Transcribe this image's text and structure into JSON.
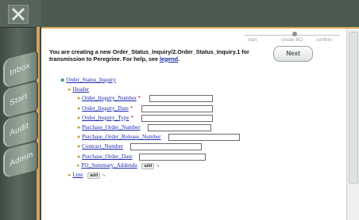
{
  "nav": {
    "tabs": [
      {
        "label": "Inbox"
      },
      {
        "label": "Start"
      },
      {
        "label": "Audit"
      },
      {
        "label": "Admin"
      }
    ]
  },
  "wizard": {
    "steps": [
      "start",
      "create BO",
      "confirm"
    ],
    "next_label": "Next"
  },
  "intro": {
    "text": "You are creating a new Order_Status_Inquiry/2.Order_Status_Inquiry.1 for transmission to Peregrine. For help, see",
    "link": "legend",
    "tail": "."
  },
  "tree": {
    "root": "Order_Status_Inquiry",
    "header": "Header",
    "fields": [
      {
        "label": "Order_Inquiry_Number",
        "required": true,
        "value": ""
      },
      {
        "label": "Order_Inquiry_Date",
        "required": true,
        "value": ""
      },
      {
        "label": "Order_Inquiry_Type",
        "required": true,
        "value": ""
      },
      {
        "label": "Purchase_Order_Number",
        "required": false,
        "value": ""
      },
      {
        "label": "Purchase_Order_Release_Number",
        "required": false,
        "value": ""
      },
      {
        "label": "Contract_Number",
        "required": false,
        "value": ""
      },
      {
        "label": "Purchase_Order_Date",
        "required": false,
        "value": ""
      }
    ],
    "addenda": "PO_Summary_Addenda",
    "line": "Line",
    "add_label": "add",
    "required_mark": "*"
  },
  "colors": {
    "link": "#1e2ab0",
    "required": "#cc0000",
    "accent": "#d4a35a",
    "rail": "#4a5a50"
  }
}
